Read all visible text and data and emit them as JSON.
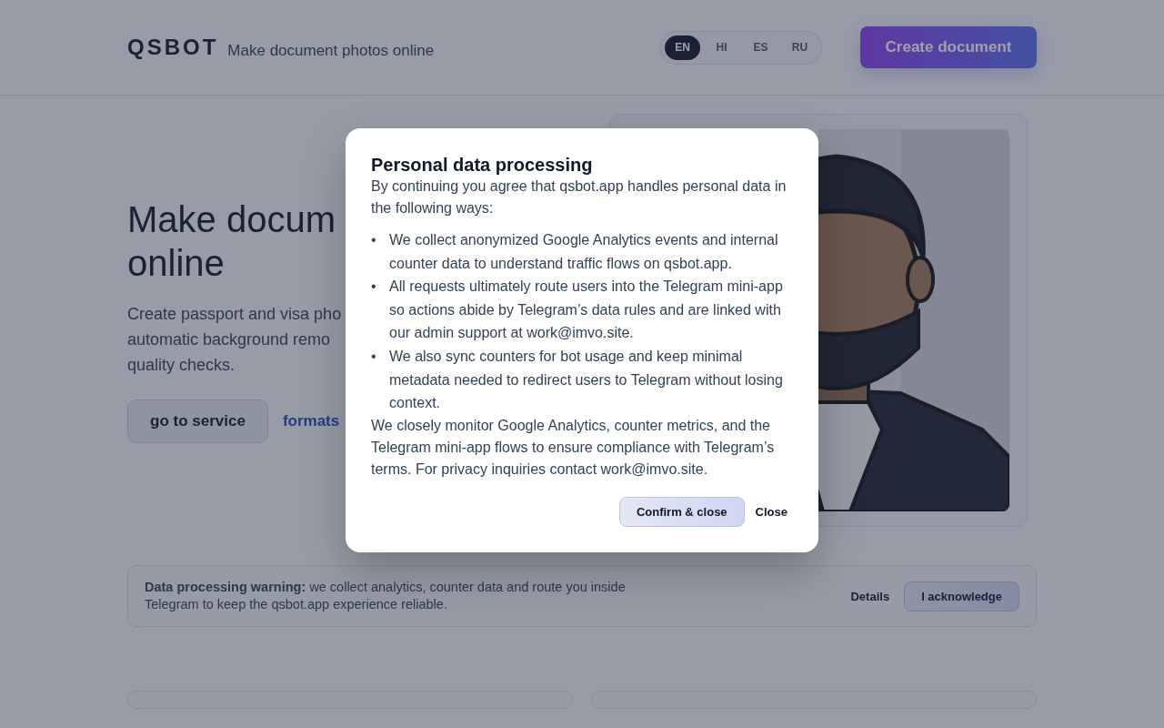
{
  "header": {
    "logo": "QSBOT",
    "tagline": "Make document photos online",
    "languages": [
      {
        "label": "EN",
        "selected": true
      },
      {
        "label": "HI",
        "selected": false
      },
      {
        "label": "ES",
        "selected": false
      },
      {
        "label": "RU",
        "selected": false
      }
    ],
    "cta": "Create document"
  },
  "hero": {
    "title_lines": [
      "Make docum",
      "online"
    ],
    "subtitle_lines": [
      "Create passport and visa pho",
      "automatic background remo",
      "quality checks."
    ],
    "primary_button": "go to service",
    "link": "formats",
    "illustration": {
      "kind": "picture"
    }
  },
  "banner": {
    "text": "**Data processing warning:** we collect analytics, counter data and route you inside Telegram to keep the qsbot.app experience reliable.",
    "details": "Details",
    "acknowledge": "I acknowledge"
  },
  "modal": {
    "title": "Personal data processing",
    "bullet": "•",
    "intro": "By continuing you agree that qsbot.app handles personal data in the following ways:",
    "items": [
      "We collect anonymized Google Analytics events and internal counter data to understand traffic flows on qsbot.app.",
      "All requests ultimately route users into the Telegram mini-app so actions abide by Telegram’s data rules and are linked with our admin support at work@imvo.site.",
      "We also sync counters for bot usage and keep minimal metadata needed to redirect users to Telegram without losing context."
    ],
    "outro": "We closely monitor Google Analytics, counter metrics, and the Telegram mini-app flows to ensure compliance with Telegram’s terms. For privacy inquiries contact work@imvo.site.",
    "confirm": "Confirm & close",
    "close": "Close"
  }
}
